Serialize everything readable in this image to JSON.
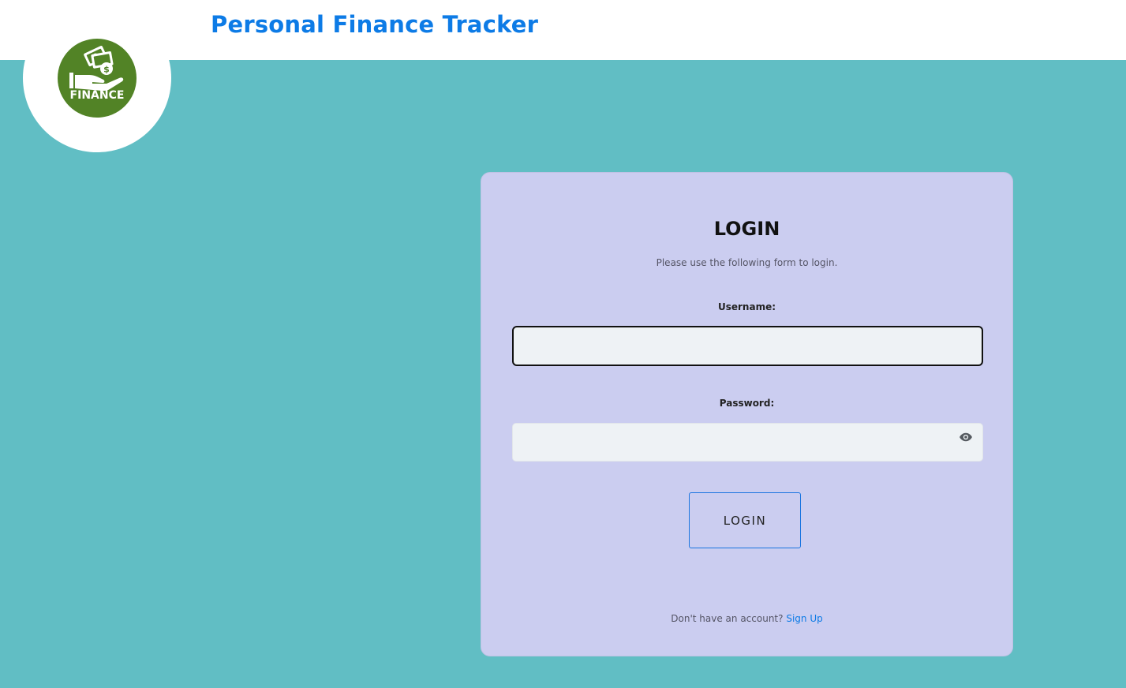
{
  "header": {
    "title": "Personal Finance Tracker"
  },
  "logo": {
    "text": "FINANCE",
    "badge_color": "#528326"
  },
  "login_form": {
    "title": "LOGIN",
    "subtitle": "Please use the following form to login.",
    "username_label": "Username:",
    "username_value": "",
    "password_label": "Password:",
    "password_value": "",
    "submit_label": "LOGIN",
    "signup_prompt": "Don't have an account?",
    "signup_link": "Sign Up"
  },
  "colors": {
    "page_background": "#61bec4",
    "header_background": "#ffffff",
    "title_color": "#0d7be6",
    "card_background": "#cbcdf0",
    "input_background": "#eef2f5",
    "button_border": "#1a74e0",
    "link_color": "#0d7be6"
  },
  "icons": {
    "password_toggle": "eye-icon",
    "logo_graphic": "hand-money-icon"
  }
}
